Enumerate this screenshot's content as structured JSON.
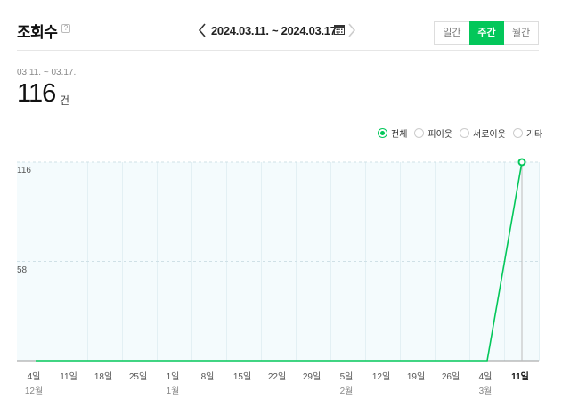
{
  "header": {
    "title": "조회수",
    "help": "?",
    "date_range": "2024.03.11. ~ 2024.03.17.",
    "tabs": [
      {
        "label": "일간",
        "active": false
      },
      {
        "label": "주간",
        "active": true
      },
      {
        "label": "월간",
        "active": false
      }
    ]
  },
  "summary": {
    "period": "03.11. ~ 03.17.",
    "total": "116",
    "unit": "건"
  },
  "legend": [
    {
      "label": "전체",
      "selected": true
    },
    {
      "label": "피이웃",
      "selected": false
    },
    {
      "label": "서로이웃",
      "selected": false
    },
    {
      "label": "기타",
      "selected": false
    }
  ],
  "colors": {
    "accent": "#03c75a",
    "plot_bg": "#f4fbfd"
  },
  "chart_data": {
    "type": "line",
    "x": [
      "4일",
      "11일",
      "18일",
      "25일",
      "1일",
      "8일",
      "15일",
      "22일",
      "29일",
      "5일",
      "12일",
      "19일",
      "26일",
      "4일",
      "11일"
    ],
    "month_labels": [
      "12월",
      "",
      "",
      "",
      "1월",
      "",
      "",
      "",
      "",
      "2월",
      "",
      "",
      "",
      "3월",
      ""
    ],
    "series": [
      {
        "values": [
          0,
          0,
          0,
          0,
          0,
          0,
          0,
          0,
          0,
          0,
          0,
          0,
          0,
          0,
          116
        ]
      }
    ],
    "yticks": [
      58,
      116
    ],
    "ylim": [
      0,
      116
    ],
    "grid": true
  }
}
